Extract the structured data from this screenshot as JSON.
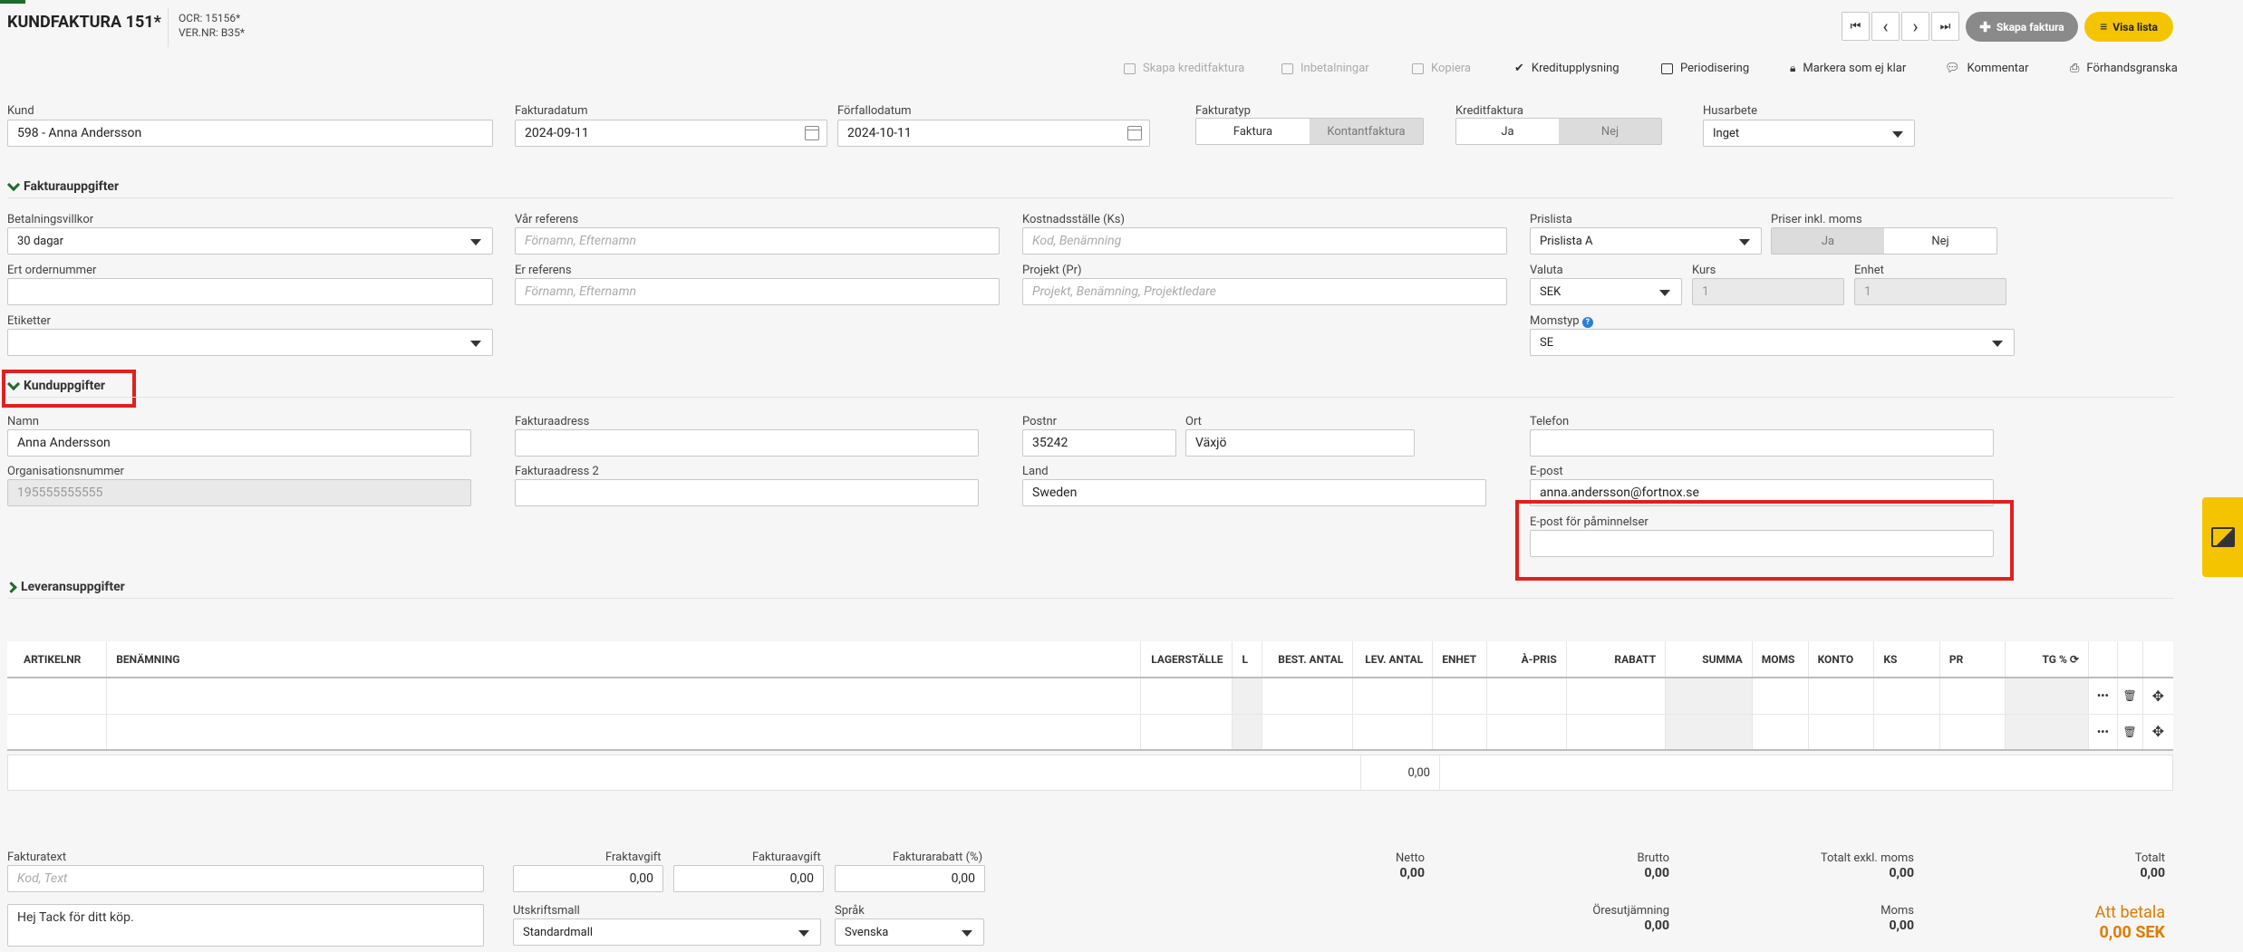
{
  "header": {
    "title": "KUNDFAKTURA 151*",
    "ocr": "OCR: 15156*",
    "vernr": "VER.NR: B35*",
    "nav": {
      "first": "⏮",
      "prev": "‹",
      "next": "›",
      "last": "⏭"
    },
    "create_invoice": "Skapa faktura",
    "show_list": "Visa lista"
  },
  "toolbar": {
    "create_credit": "Skapa kreditfaktura",
    "payments": "Inbetalningar",
    "copy": "Kopiera",
    "credit_info": "Kreditupplysning",
    "periodize": "Periodisering",
    "mark_unready": "Markera som ej klar",
    "comment": "Kommentar",
    "preview": "Förhandsgranska"
  },
  "top": {
    "kund_label": "Kund",
    "kund_value": "598 - Anna Andersson",
    "fakturadatum_label": "Fakturadatum",
    "fakturadatum_value": "2024-09-11",
    "forfallodatum_label": "Förfallodatum",
    "forfallodatum_value": "2024-10-11",
    "fakturatyp_label": "Fakturatyp",
    "fakturatyp_opt1": "Faktura",
    "fakturatyp_opt2": "Kontantfaktura",
    "kreditfaktura_label": "Kreditfaktura",
    "kredit_ja": "Ja",
    "kredit_nej": "Nej",
    "husarbete_label": "Husarbete",
    "husarbete_value": "Inget"
  },
  "faktura": {
    "section": "Fakturauppgifter",
    "betalningsvillkor_label": "Betalningsvillkor",
    "betalningsvillkor_value": "30 dagar",
    "var_referens_label": "Vår referens",
    "var_referens_ph": "Förnamn, Efternamn",
    "kostnadsstalle_label": "Kostnadsställe (Ks)",
    "kostnadsstalle_ph": "Kod, Benämning",
    "prislista_label": "Prislista",
    "prislista_value": "Prislista A",
    "priser_label": "Priser inkl. moms",
    "priser_ja": "Ja",
    "priser_nej": "Nej",
    "ordernummer_label": "Ert ordernummer",
    "er_referens_label": "Er referens",
    "er_referens_ph": "Förnamn, Efternamn",
    "projekt_label": "Projekt (Pr)",
    "projekt_ph": "Projekt, Benämning, Projektledare",
    "valuta_label": "Valuta",
    "valuta_value": "SEK",
    "kurs_label": "Kurs",
    "kurs_value": "1",
    "enhet_label": "Enhet",
    "enhet_value": "1",
    "etiketter_label": "Etiketter",
    "momstyp_label": "Momstyp",
    "momstyp_value": "SE"
  },
  "kund": {
    "section": "Kunduppgifter",
    "namn_label": "Namn",
    "namn_value": "Anna Andersson",
    "fakturaadress_label": "Fakturaadress",
    "postnr_label": "Postnr",
    "postnr_value": "35242",
    "ort_label": "Ort",
    "ort_value": "Växjö",
    "telefon_label": "Telefon",
    "orgnr_label": "Organisationsnummer",
    "orgnr_value": "195555555555",
    "fakturaadress2_label": "Fakturaadress 2",
    "land_label": "Land",
    "land_value": "Sweden",
    "epost_label": "E-post",
    "epost_value": "anna.andersson@fortnox.se",
    "epost_paminnelser_label": "E-post för påminnelser"
  },
  "leverans": {
    "section": "Leveransuppgifter"
  },
  "table": {
    "headers": [
      "ARTIKELNR",
      "BENÄMNING",
      "LAGERSTÄLLE",
      "L",
      "BEST. ANTAL",
      "LEV. ANTAL",
      "ENHET",
      "À-PRIS",
      "RABATT",
      "SUMMA",
      "MOMS",
      "KONTO",
      "KS",
      "PR",
      "TG %"
    ],
    "total_lev": "0,00"
  },
  "bottom": {
    "fakturatext_label": "Fakturatext",
    "fakturatext_ph": "Kod, Text",
    "fraktavgift_label": "Fraktavgift",
    "fraktavgift_value": "0,00",
    "fakturaavgift_label": "Fakturaavgift",
    "fakturaavgift_value": "0,00",
    "fakturarabatt_label": "Fakturarabatt (%)",
    "fakturarabatt_value": "0,00",
    "fakturatext_value": "Hej Tack för ditt köp.",
    "utskriftsmall_label": "Utskriftsmall",
    "utskriftsmall_value": "Standardmall",
    "sprak_label": "Språk",
    "sprak_value": "Svenska",
    "netto_label": "Netto",
    "netto_value": "0,00",
    "brutto_label": "Brutto",
    "brutto_value": "0,00",
    "exkl_label": "Totalt exkl. moms",
    "exkl_value": "0,00",
    "totalt_label": "Totalt",
    "totalt_value": "0,00",
    "oresutjamning_label": "Öresutjämning",
    "oresutjamning_value": "0,00",
    "moms_label": "Moms",
    "moms_value": "0,00",
    "att_betala_label": "Att betala",
    "att_betala_value": "0,00 SEK"
  },
  "colors": {
    "accent": "#f5c400",
    "brand_green": "#1f6b2f",
    "highlight": "#e02020",
    "amount_orange": "#e07b00"
  }
}
